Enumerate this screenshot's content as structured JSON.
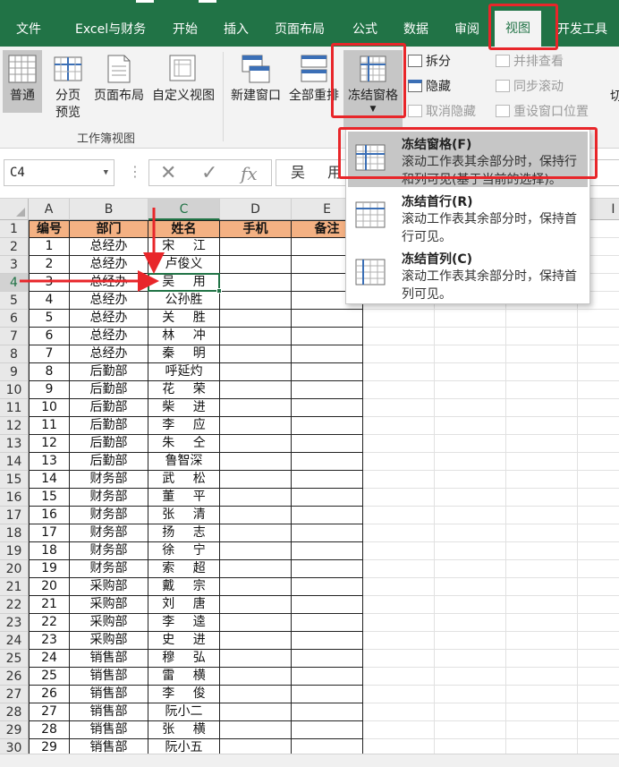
{
  "tabs": [
    {
      "label": "文件"
    },
    {
      "label": "Excel与财务"
    },
    {
      "label": "开始"
    },
    {
      "label": "插入"
    },
    {
      "label": "页面布局"
    },
    {
      "label": "公式"
    },
    {
      "label": "数据"
    },
    {
      "label": "审阅"
    },
    {
      "label": "视图"
    },
    {
      "label": "开发工具"
    }
  ],
  "ribbon": {
    "normal": "普通",
    "page_break_line1": "分页",
    "page_break_line2": "预览",
    "page_layout": "页面布局",
    "custom_view": "自定义视图",
    "group_workbook_views": "工作簿视图",
    "new_window": "新建窗口",
    "arrange_all": "全部重排",
    "freeze_panes": "冻结窗格",
    "split": "拆分",
    "hide": "隐藏",
    "unhide": "取消隐藏",
    "view_side_by_side": "并排查看",
    "sync_scroll": "同步滚动",
    "reset_window": "重设窗口位置",
    "switch_partial": "切"
  },
  "formula_bar": {
    "name_box": "C4",
    "fx": "fx",
    "value": "吴 用"
  },
  "freeze_menu": {
    "items": [
      {
        "title": "冻结窗格(F)",
        "desc": "滚动工作表其余部分时，保持行和列可见(基于当前的选择)。"
      },
      {
        "title": "冻结首行(R)",
        "desc": "滚动工作表其余部分时，保持首行可见。"
      },
      {
        "title": "冻结首列(C)",
        "desc": "滚动工作表其余部分时，保持首列可见。"
      }
    ]
  },
  "sheet": {
    "columns": [
      "A",
      "B",
      "C",
      "D",
      "E",
      "I"
    ],
    "header_row": [
      "编号",
      "部门",
      "姓名",
      "手机",
      "备注"
    ],
    "rows": [
      [
        "1",
        "总经办",
        "宋 江"
      ],
      [
        "2",
        "总经办",
        "卢俊义"
      ],
      [
        "3",
        "总经办",
        "吴 用"
      ],
      [
        "4",
        "总经办",
        "公孙胜"
      ],
      [
        "5",
        "总经办",
        "关 胜"
      ],
      [
        "6",
        "总经办",
        "林 冲"
      ],
      [
        "7",
        "总经办",
        "秦 明"
      ],
      [
        "8",
        "后勤部",
        "呼延灼"
      ],
      [
        "9",
        "后勤部",
        "花 荣"
      ],
      [
        "10",
        "后勤部",
        "柴 进"
      ],
      [
        "11",
        "后勤部",
        "李 应"
      ],
      [
        "12",
        "后勤部",
        "朱 仝"
      ],
      [
        "13",
        "后勤部",
        "鲁智深"
      ],
      [
        "14",
        "财务部",
        "武 松"
      ],
      [
        "15",
        "财务部",
        "董 平"
      ],
      [
        "16",
        "财务部",
        "张 清"
      ],
      [
        "17",
        "财务部",
        "扬 志"
      ],
      [
        "18",
        "财务部",
        "徐 宁"
      ],
      [
        "19",
        "财务部",
        "索 超"
      ],
      [
        "20",
        "采购部",
        "戴 宗"
      ],
      [
        "21",
        "采购部",
        "刘 唐"
      ],
      [
        "22",
        "采购部",
        "李 逵"
      ],
      [
        "23",
        "采购部",
        "史 进"
      ],
      [
        "24",
        "销售部",
        "穆 弘"
      ],
      [
        "25",
        "销售部",
        "雷 横"
      ],
      [
        "26",
        "销售部",
        "李 俊"
      ],
      [
        "27",
        "销售部",
        "阮小二"
      ],
      [
        "28",
        "销售部",
        "张 横"
      ],
      [
        "29",
        "销售部",
        "阮小五"
      ]
    ]
  },
  "colors": {
    "accent_green": "#217346",
    "header_fill": "#f4b183",
    "annotation_red": "#e8262a"
  }
}
